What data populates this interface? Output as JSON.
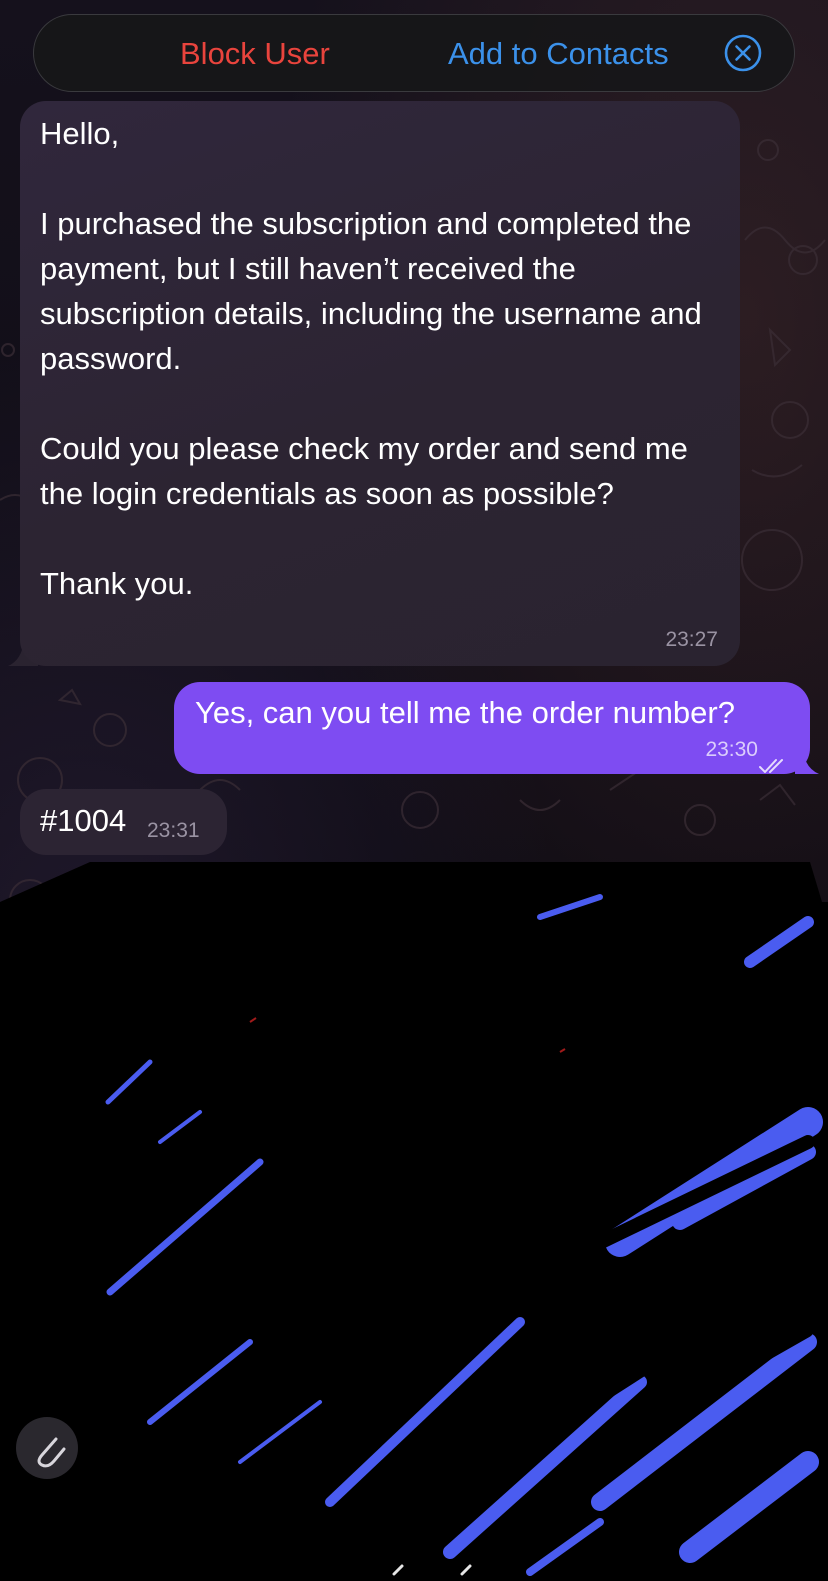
{
  "action_bar": {
    "block_label": "Block User",
    "add_contact_label": "Add to Contacts",
    "close_icon": "close-circle-icon"
  },
  "messages": [
    {
      "direction": "incoming",
      "paragraphs": [
        "Hello,",
        "I purchased the subscription and completed the payment, but I still haven’t received the subscription details, including the username and password.",
        "Could you please check my order and send me the login credentials as soon as possible?",
        "Thank you."
      ],
      "time": "23:27"
    },
    {
      "direction": "outgoing",
      "text": "Yes, can you tell me the order number?",
      "time": "23:30",
      "status_icon": "double-check-icon"
    },
    {
      "direction": "incoming",
      "text": "#1004",
      "time": "23:31"
    }
  ],
  "colors": {
    "block": "#e9443d",
    "link": "#3b91ea",
    "outgoing_bubble": "#7e4cf2",
    "incoming_bubble": "#2c2433"
  },
  "composer": {
    "attach_icon": "paperclip-icon"
  }
}
